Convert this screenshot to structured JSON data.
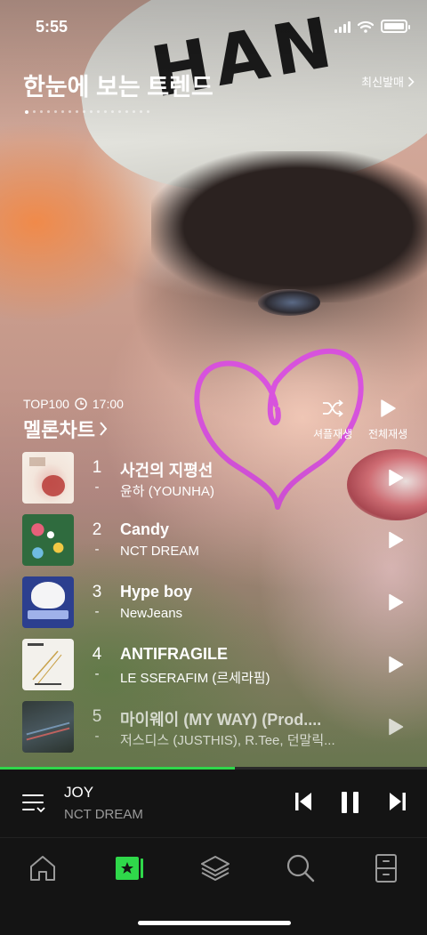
{
  "status_bar": {
    "time": "5:55"
  },
  "trend": {
    "title": "한눈에 보는 트렌드",
    "new_release_link": "최신발매",
    "carousel_pages": 18,
    "carousel_active_index": 0
  },
  "chart": {
    "top_label": "TOP100",
    "update_time": "17:00",
    "title": "멜론차트",
    "shuffle_label": "셔플재생",
    "play_all_label": "전체재생",
    "songs": [
      {
        "rank": "1",
        "change": "-",
        "title": "사건의 지평선",
        "artist": "윤하 (YOUNHA)"
      },
      {
        "rank": "2",
        "change": "-",
        "title": "Candy",
        "artist": "NCT DREAM"
      },
      {
        "rank": "3",
        "change": "-",
        "title": "Hype boy",
        "artist": "NewJeans"
      },
      {
        "rank": "4",
        "change": "-",
        "title": "ANTIFRAGILE",
        "artist": "LE SSERAFIM (르세라핌)"
      },
      {
        "rank": "5",
        "change": "-",
        "title": "마이웨이 (MY WAY) (Prod....",
        "artist": "저스디스 (JUSTHIS), R.Tee, 던말릭..."
      }
    ]
  },
  "now_playing": {
    "title": "JOY",
    "artist": "NCT DREAM",
    "progress_fraction": 0.55
  },
  "colors": {
    "accent_green": "#2fd84a",
    "heart_doodle": "#d84be3",
    "player_bg": "#141414"
  },
  "icons": {
    "tabs": [
      "home-icon",
      "my-music-icon",
      "layers-icon",
      "search-icon",
      "library-icon"
    ],
    "active_tab": "my-music-icon"
  }
}
